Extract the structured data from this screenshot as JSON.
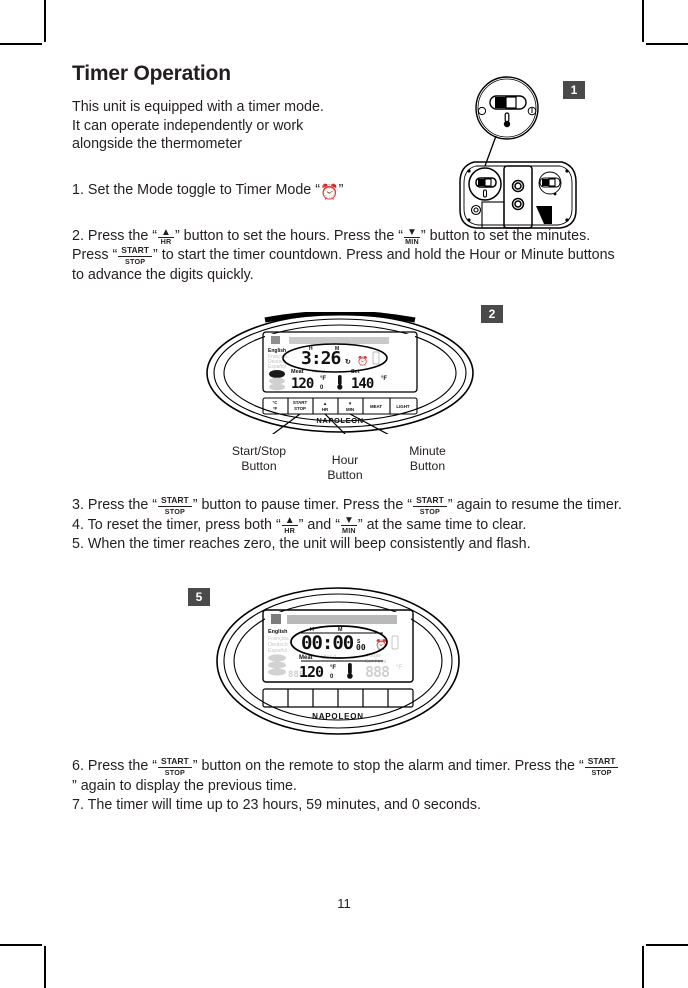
{
  "document": {
    "heading": "Timer Operation",
    "intro": "This unit is equipped with a timer mode.\nIt can operate independently or work\nalongside the thermometer",
    "page_number": "11"
  },
  "glyphs": {
    "hour_button": {
      "top": "▲",
      "bottom": "HR",
      "name": "hour-button-glyph"
    },
    "minute_button": {
      "top": "▼",
      "bottom": "MIN",
      "name": "minute-button-glyph"
    },
    "start_stop_button": {
      "top": "START",
      "bottom": "STOP",
      "name": "start-stop-button-glyph"
    },
    "timer_mode_icon": "⏰"
  },
  "steps": [
    {
      "number": "1.",
      "parts": [
        {
          "type": "text",
          "value": "Set the Mode toggle to Timer Mode “"
        },
        {
          "type": "clock"
        },
        {
          "type": "text",
          "value": "”"
        }
      ]
    },
    {
      "number": "2.",
      "parts": [
        {
          "type": "text",
          "value": "Press the “"
        },
        {
          "type": "glyph",
          "value": "hour_button"
        },
        {
          "type": "text",
          "value": "” button to set the hours.  Press the “"
        },
        {
          "type": "glyph",
          "value": "minute_button"
        },
        {
          "type": "text",
          "value": "” button to set the minutes.  Press “"
        },
        {
          "type": "glyph",
          "value": "start_stop_button"
        },
        {
          "type": "text",
          "value": "” to start the timer countdown.  Press and hold the Hour or Minute buttons to advance the digits quickly."
        }
      ]
    },
    {
      "number": "3.",
      "parts": [
        {
          "type": "text",
          "value": "Press the “"
        },
        {
          "type": "glyph",
          "value": "start_stop_button"
        },
        {
          "type": "text",
          "value": "” button to pause timer.  Press the “"
        },
        {
          "type": "glyph",
          "value": "start_stop_button"
        },
        {
          "type": "text",
          "value": "” again to resume the timer."
        }
      ]
    },
    {
      "number": "4.",
      "parts": [
        {
          "type": "text",
          "value": "To reset the timer, press both “"
        },
        {
          "type": "glyph",
          "value": "hour_button"
        },
        {
          "type": "text",
          "value": "” and  “"
        },
        {
          "type": "glyph",
          "value": "minute_button"
        },
        {
          "type": "text",
          "value": "” at the same time to clear."
        }
      ]
    },
    {
      "number": "5.",
      "parts": [
        {
          "type": "text",
          "value": "When the timer reaches zero, the unit will beep consistently and flash."
        }
      ]
    },
    {
      "number": "6.",
      "parts": [
        {
          "type": "text",
          "value": "Press the “"
        },
        {
          "type": "glyph",
          "value": "start_stop_button"
        },
        {
          "type": "text",
          "value": "” button on the remote to stop the alarm and timer.  Press the “"
        },
        {
          "type": "glyph",
          "value": "start_stop_button"
        },
        {
          "type": "text",
          "value": "” again to display the previous time."
        }
      ]
    },
    {
      "number": "7.",
      "parts": [
        {
          "type": "text",
          "value": "The timer will time up to 23 hours, 59 minutes, and 0 seconds."
        }
      ]
    }
  ],
  "figures": [
    {
      "badge": "1",
      "name": "device-back-mode-toggle-figure",
      "caption": null,
      "detail": {
        "toggle_icons": [
          "timer-clock",
          "thermometer",
          "power"
        ]
      }
    },
    {
      "badge": "2",
      "name": "remote-timer-running-figure",
      "display": {
        "time": "3:26",
        "hr_label": "H",
        "min_label": "M",
        "seconds": "",
        "alarm_icon": "⏰",
        "meat_label": "Meat",
        "set_label": "Set",
        "meat_temp": "120",
        "meat_temp_decimal": "0",
        "meat_unit": "°F",
        "target_temp": "140",
        "target_unit": "°F",
        "languages": [
          "English",
          "Français",
          "Deutsch",
          "Español"
        ],
        "brand": "NAPOLEON"
      },
      "buttons": [
        "°C/°F",
        "START/STOP",
        "▲ HR",
        "▼ MIN",
        "MEAT",
        "LIGHT"
      ],
      "callouts": [
        {
          "label": "Start/Stop\nButton",
          "name": "callout-start-stop-button"
        },
        {
          "label": "Hour\nButton",
          "name": "callout-hour-button"
        },
        {
          "label": "Minute\nButton",
          "name": "callout-minute-button"
        }
      ]
    },
    {
      "badge": "5",
      "name": "remote-timer-zero-figure",
      "display": {
        "time": "00:00",
        "hr_label": "H",
        "min_label": "M",
        "seconds": "00",
        "seconds_marker": "S",
        "alarm_icon": "⏰",
        "meat_label": "Meat",
        "set_label": "Régle / Set Final",
        "meat_temp": "120",
        "meat_temp_decimal": "0",
        "meat_unit": "°F",
        "target_temp": "888",
        "target_unit": "°F",
        "languages": [
          "English",
          "Français",
          "Deutsch",
          "Español"
        ],
        "brand": "NAPOLEON"
      }
    }
  ],
  "colors": {
    "text": "#231f20",
    "badge_bg": "#4a4a4a",
    "badge_text": "#ffffff",
    "line": "#000000"
  }
}
